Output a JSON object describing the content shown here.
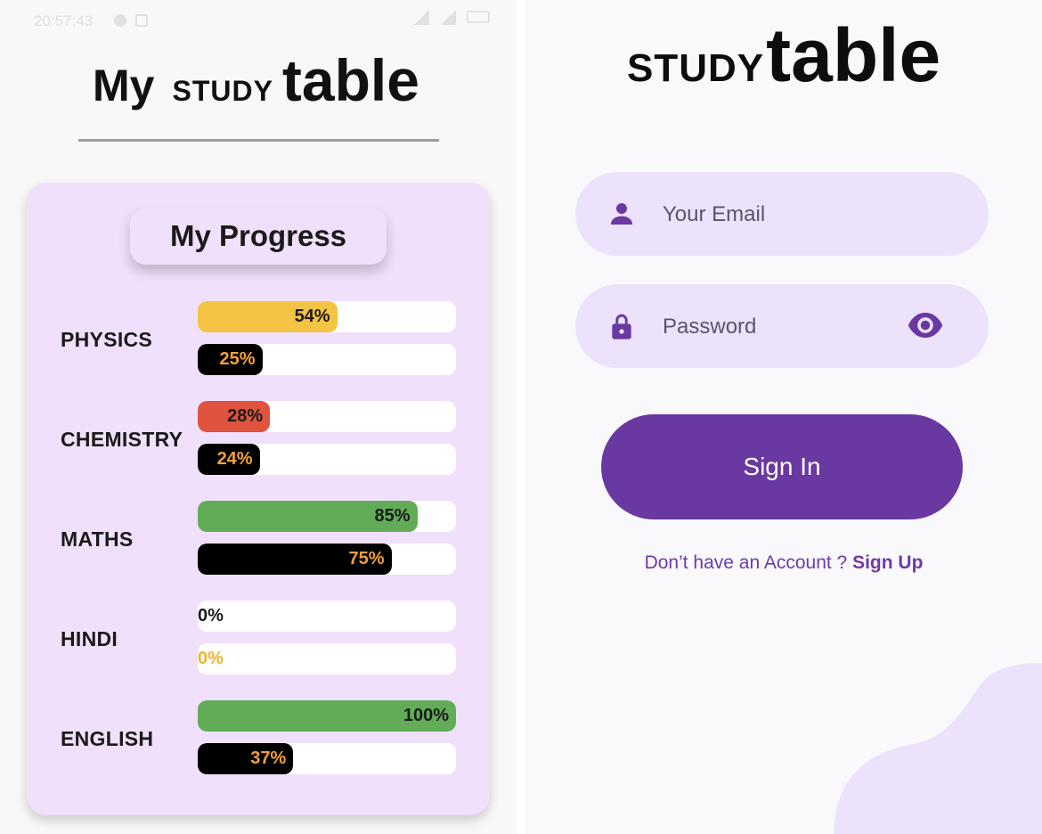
{
  "left_screen": {
    "status_time": "20:57:43",
    "title": {
      "my": "My",
      "study": "STUDY",
      "table": "table"
    },
    "progress_title": "My Progress",
    "subjects": [
      {
        "name": "PHYSICS",
        "bar1": {
          "label": "54%",
          "value": 0.54,
          "color": "#f5c343",
          "text_color": "#1a1a1a"
        },
        "bar2": {
          "label": "25%",
          "value": 0.25,
          "color": "#000000",
          "text_color": "#f2a03a"
        }
      },
      {
        "name": "CHEMISTRY",
        "bar1": {
          "label": "28%",
          "value": 0.28,
          "color": "#e0533f",
          "text_color": "#1a1a1a"
        },
        "bar2": {
          "label": "24%",
          "value": 0.24,
          "color": "#000000",
          "text_color": "#f2a03a"
        }
      },
      {
        "name": "MATHS",
        "bar1": {
          "label": "85%",
          "value": 0.85,
          "color": "#62ac58",
          "text_color": "#1a1a1a"
        },
        "bar2": {
          "label": "75%",
          "value": 0.75,
          "color": "#000000",
          "text_color": "#f2a03a"
        }
      },
      {
        "name": "HINDI",
        "bar1": {
          "label": "0%",
          "value": 0,
          "color": "#62ac58",
          "text_color": "#1a1a1a"
        },
        "bar2": {
          "label": "0%",
          "value": 0,
          "color": "#000000",
          "text_color": "#f2b430"
        }
      },
      {
        "name": "ENGLISH",
        "bar1": {
          "label": "100%",
          "value": 1.0,
          "color": "#62ac58",
          "text_color": "#1a1a1a"
        },
        "bar2": {
          "label": "37%",
          "value": 0.37,
          "color": "#000000",
          "text_color": "#f2a03a"
        }
      }
    ]
  },
  "right_screen": {
    "brand": {
      "study": "STUDY",
      "table": "table"
    },
    "email_placeholder": "Your Email",
    "password_placeholder": "Password",
    "sign_in_label": "Sign In",
    "signup_prompt": "Don’t have an Account ? ",
    "signup_link": "Sign Up",
    "accent_color": "#6938a0",
    "field_color": "#ede2fc",
    "icons": {
      "email": "person-icon",
      "password": "lock-icon",
      "visibility": "eye-icon"
    }
  }
}
